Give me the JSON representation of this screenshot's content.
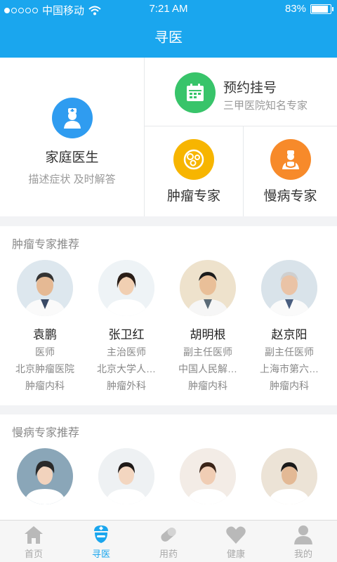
{
  "status": {
    "carrier": "中国移动",
    "time": "7:21 AM",
    "battery": "83%"
  },
  "header": {
    "title": "寻医"
  },
  "services": {
    "family": {
      "title": "家庭医生",
      "subtitle": "描述症状 及时解答",
      "icon": "doctor-icon",
      "color": "#2f9cf0"
    },
    "appointment": {
      "title": "预约挂号",
      "subtitle": "三甲医院知名专家",
      "icon": "calendar-icon",
      "color": "#38c46a"
    },
    "oncology": {
      "title": "肿瘤专家",
      "icon": "cells-icon",
      "color": "#f7b500"
    },
    "chronic": {
      "title": "慢病专家",
      "icon": "stethoscope-icon",
      "color": "#f78a2a"
    }
  },
  "oncology_section": {
    "title": "肿瘤专家推荐",
    "doctors": [
      {
        "name": "袁鹏",
        "title": "医师",
        "hospital": "北京肿瘤医院",
        "dept": "肿瘤内科"
      },
      {
        "name": "张卫红",
        "title": "主治医师",
        "hospital": "北京大学人…",
        "dept": "肿瘤外科"
      },
      {
        "name": "胡明根",
        "title": "副主任医师",
        "hospital": "中国人民解…",
        "dept": "肿瘤内科"
      },
      {
        "name": "赵京阳",
        "title": "副主任医师",
        "hospital": "上海市第六…",
        "dept": "肿瘤内科"
      }
    ]
  },
  "chronic_section": {
    "title": "慢病专家推荐"
  },
  "tabbar": {
    "tabs": [
      {
        "label": "首页",
        "icon": "home-icon"
      },
      {
        "label": "寻医",
        "icon": "nurse-icon"
      },
      {
        "label": "用药",
        "icon": "pill-icon"
      },
      {
        "label": "健康",
        "icon": "heart-icon"
      },
      {
        "label": "我的",
        "icon": "user-icon"
      }
    ],
    "active": "寻医"
  }
}
